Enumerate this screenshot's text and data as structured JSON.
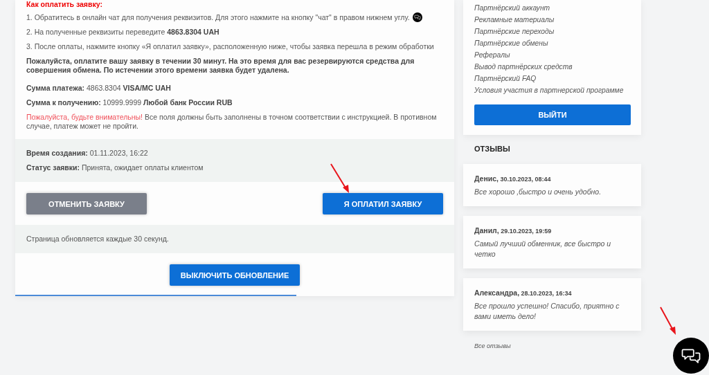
{
  "payment": {
    "heading": "Как оплатить заявку:",
    "steps": [
      "1. Обратитесь в онлайн чат для получения реквизитов. Для этого нажмите на кнопку \"чат\" в правом нижнем углу.",
      "2. На полученные реквизиты переведите **4863.8304 UAH**",
      "3. После оплаты, нажмите кнопку «Я оплатил заявку», расположенную ниже, чтобы заявка перешла в режим обработки"
    ],
    "notice": "Пожалуйста, оплатите вашу заявку в течении 30 минут. На это время для вас резервируются средства для совершения обмена. По истечении этого времени заявка будет удалена.",
    "sums": [
      "**Сумма платежа:** 4863.8304 **VISA/MC UAH**",
      "**Сумма к получению:** 10999.9999 **Любой банк России RUB**"
    ],
    "warning": {
      "highlight": "Пожалуйста, будьте внимательны!",
      "text": " Все поля должны быть заполнены в точном соответствии с инструкцией. В противном случае, платеж может не пройти."
    },
    "info": [
      "**Время создания:** 01.11.2023, 16:22",
      "**Статус заявки:** Принята, ожидает оплаты клиентом"
    ],
    "buttons": [
      {
        "label": "ОТМЕНИТЬ ЗАЯВКУ",
        "kind": "secondary"
      },
      {
        "label": "Я ОПЛАТИЛ ЗАЯВКУ",
        "kind": "primary"
      }
    ],
    "refresh_note": "Страница обновляется каждые 30 секунд.",
    "refresh_button": "ВЫКЛЮЧИТЬ ОБНОВЛЕНИЕ",
    "refresh_progress": {
      "level": 0.64
    }
  },
  "partner_menu": {
    "items": [
      "Партнёрский аккаунт",
      "Рекламные материалы",
      "Партнёрские переходы",
      "Партнёрские обмены",
      "Рефералы",
      "Вывод партнёрских средств",
      "Партнёрский FAQ",
      "Условия участия в партнерской программе"
    ],
    "logout": "ВЫЙТИ"
  },
  "reviews": {
    "title": "ОТЗЫВЫ",
    "items": [
      {
        "author": "Денис,",
        "date": "30.10.2023, 08:44",
        "text": "Все хорошо ,быстро и очень удобно."
      },
      {
        "author": "Данил,",
        "date": "29.10.2023, 19:59",
        "text": "Самый лучший обменник, все быстро и четко"
      },
      {
        "author": "Александра,",
        "date": "28.10.2023, 16:34",
        "text": "Все прошло успешно! Спасибо, приятно с вами иметь дело!"
      }
    ],
    "all_link": "Все отзывы"
  }
}
